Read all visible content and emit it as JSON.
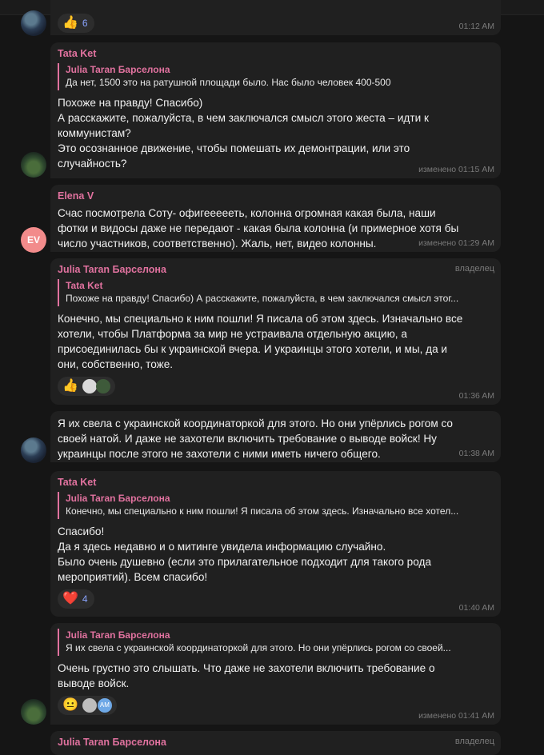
{
  "messages": [
    {
      "time": "01:12 AM",
      "reaction_count": "6"
    },
    {
      "author": "Tata Ket",
      "reply_name": "Julia Taran Барселона",
      "reply_text": "Да нет, 1500 это на ратушной площади было. Нас было человек 400-500",
      "lines": [
        "Похоже на правду! Спасибо)",
        "А расскажите, пожалуйста, в чем заключался смысл этого жеста – идти к",
        "коммунистам?",
        "Это осознанное движение, чтобы помешать их демонтрации, или это",
        "случайность?"
      ],
      "time": "изменено 01:15 AM"
    },
    {
      "author": "Elena V",
      "avatar_initials": "EV",
      "lines": [
        "Счас посмотрела Соту- офигеееееть, колонна огромная какая была, наши",
        "фотки и видосы даже не передают - какая была колонна (и примерное хотя бы",
        "число участников, соответственно). Жаль, нет, видео колонны."
      ],
      "time": "изменено 01:29 AM"
    },
    {
      "author": "Julia Taran Барселона",
      "owner": "владелец",
      "reply_name": "Tata Ket",
      "reply_text": "Похоже на правду! Спасибо) А расскажите, пожалуйста, в чем заключался смысл этог...",
      "lines": [
        "Конечно, мы специально к ним пошли! Я писала об этом здесь. Изначально все",
        "хотели, чтобы Платформа за мир не устраивала отдельную акцию, а",
        "присоединилась бы к украинской вчера. И украинцы этого хотели, и мы, да и",
        "они, собственно, тоже."
      ],
      "time": "01:36 AM"
    },
    {
      "lines": [
        "Я их свела с украинской координаторкой для этого. Но они упёрлись рогом со",
        "своей натой. И даже не захотели включить требование о выводе войск! Ну",
        "украинцы после этого не захотели с ними иметь ничего общего."
      ],
      "time": "01:38 AM"
    },
    {
      "author": "Tata Ket",
      "reply_name": "Julia Taran Барселона",
      "reply_text": "Конечно, мы специально к ним пошли! Я писала об этом здесь. Изначально все хотел...",
      "lines": [
        "Спасибо!",
        "Да я здесь недавно и о митинге увидела информацию случайно.",
        "Было очень душевно (если это прилагательное подходит для такого рода",
        "мероприятий). Всем спасибо!"
      ],
      "reaction_count": "4",
      "time": "01:40 AM"
    },
    {
      "reply_name": "Julia Taran Барселона",
      "reply_text": "Я их свела с украинской координаторкой для этого. Но они упёрлись рогом со своей...",
      "lines": [
        "Очень грустно это слышать. Что даже не захотели включить требование о",
        "выводе войск."
      ],
      "reaction_initials": "AM",
      "time": "изменено 01:41 AM"
    },
    {
      "author": "Julia Taran Барселона",
      "owner": "владелец"
    }
  ]
}
